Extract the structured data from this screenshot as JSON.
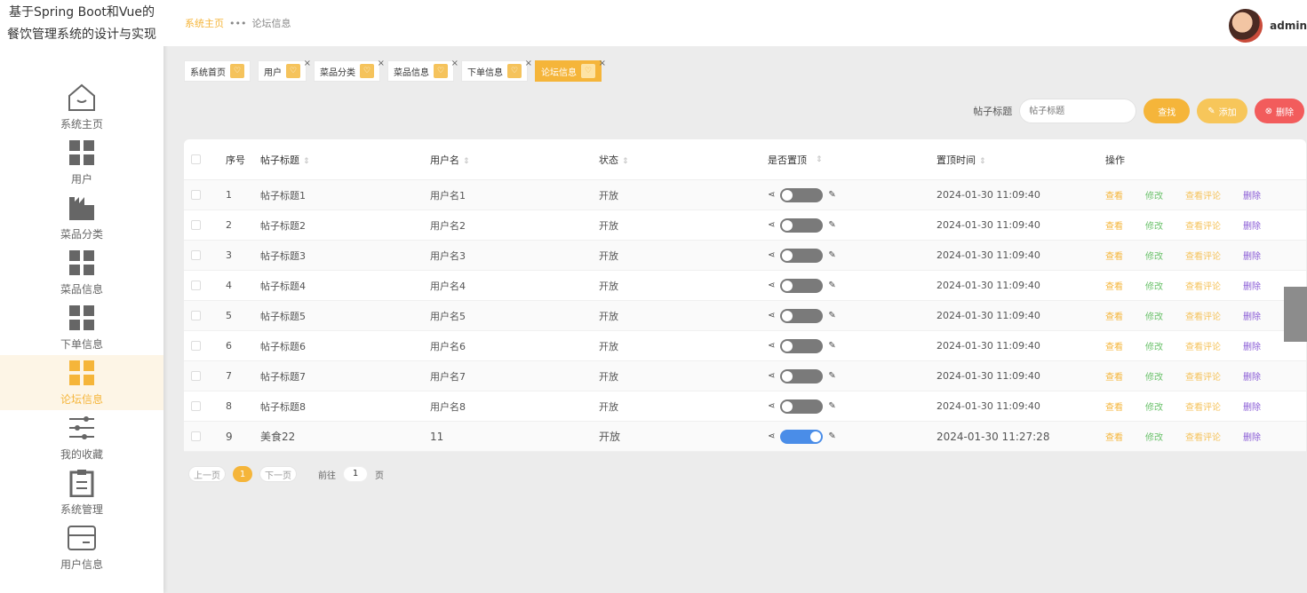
{
  "sidebar": {
    "title": "基于Spring Boot和Vue的餐饮管理系统的设计与实现",
    "items": [
      {
        "label": "系统主页",
        "icon": "home-icon"
      },
      {
        "label": "用户",
        "icon": "grid-icon"
      },
      {
        "label": "菜品分类",
        "icon": "building-icon"
      },
      {
        "label": "菜品信息",
        "icon": "grid-icon"
      },
      {
        "label": "下单信息",
        "icon": "grid-icon"
      },
      {
        "label": "论坛信息",
        "icon": "grid-icon",
        "active": true
      },
      {
        "label": "我的收藏",
        "icon": "sliders-icon"
      },
      {
        "label": "系统管理",
        "icon": "clipboard-icon"
      },
      {
        "label": "用户信息",
        "icon": "card-icon"
      }
    ]
  },
  "header": {
    "breadcrumb_home": "系统主页",
    "breadcrumb_sep": "•••",
    "breadcrumb_current": "论坛信息",
    "user_name": "admin"
  },
  "tags": [
    "系统首页",
    "用户",
    "菜品分类",
    "菜品信息",
    "下单信息",
    "论坛信息"
  ],
  "search": {
    "label": "帖子标题",
    "placeholder": "帖子标题",
    "search_btn": "查找",
    "add_btn": "添加",
    "delete_btn": "删除"
  },
  "table": {
    "headers": {
      "no": "序号",
      "title": "帖子标题",
      "user": "用户名",
      "status": "状态",
      "top": "是否置顶",
      "time": "置顶时间",
      "ops": "操作"
    },
    "rows": [
      {
        "no": "1",
        "title": "帖子标题1",
        "user": "用户名1",
        "status": "开放",
        "top": false,
        "time": "2024-01-30 11:09:40"
      },
      {
        "no": "2",
        "title": "帖子标题2",
        "user": "用户名2",
        "status": "开放",
        "top": false,
        "time": "2024-01-30 11:09:40"
      },
      {
        "no": "3",
        "title": "帖子标题3",
        "user": "用户名3",
        "status": "开放",
        "top": false,
        "time": "2024-01-30 11:09:40"
      },
      {
        "no": "4",
        "title": "帖子标题4",
        "user": "用户名4",
        "status": "开放",
        "top": false,
        "time": "2024-01-30 11:09:40"
      },
      {
        "no": "5",
        "title": "帖子标题5",
        "user": "用户名5",
        "status": "开放",
        "top": false,
        "time": "2024-01-30 11:09:40"
      },
      {
        "no": "6",
        "title": "帖子标题6",
        "user": "用户名6",
        "status": "开放",
        "top": false,
        "time": "2024-01-30 11:09:40"
      },
      {
        "no": "7",
        "title": "帖子标题7",
        "user": "用户名7",
        "status": "开放",
        "top": false,
        "time": "2024-01-30 11:09:40"
      },
      {
        "no": "8",
        "title": "帖子标题8",
        "user": "用户名8",
        "status": "开放",
        "top": false,
        "time": "2024-01-30 11:09:40"
      },
      {
        "no": "9",
        "title": "美食22",
        "user": "11",
        "status": "开放",
        "top": true,
        "time": "2024-01-30 11:27:28"
      }
    ],
    "ops": {
      "view": "查看",
      "edit": "修改",
      "comments": "查看评论",
      "delete": "删除"
    }
  },
  "pager": {
    "prev": "上一页",
    "current": "1",
    "next": "下一页",
    "goto": "前往",
    "goto_value": "1",
    "unit": "页"
  },
  "colors": {
    "accent": "#f5b53a",
    "toggle_on": "#4a8de8",
    "danger": "#f25c5c"
  }
}
